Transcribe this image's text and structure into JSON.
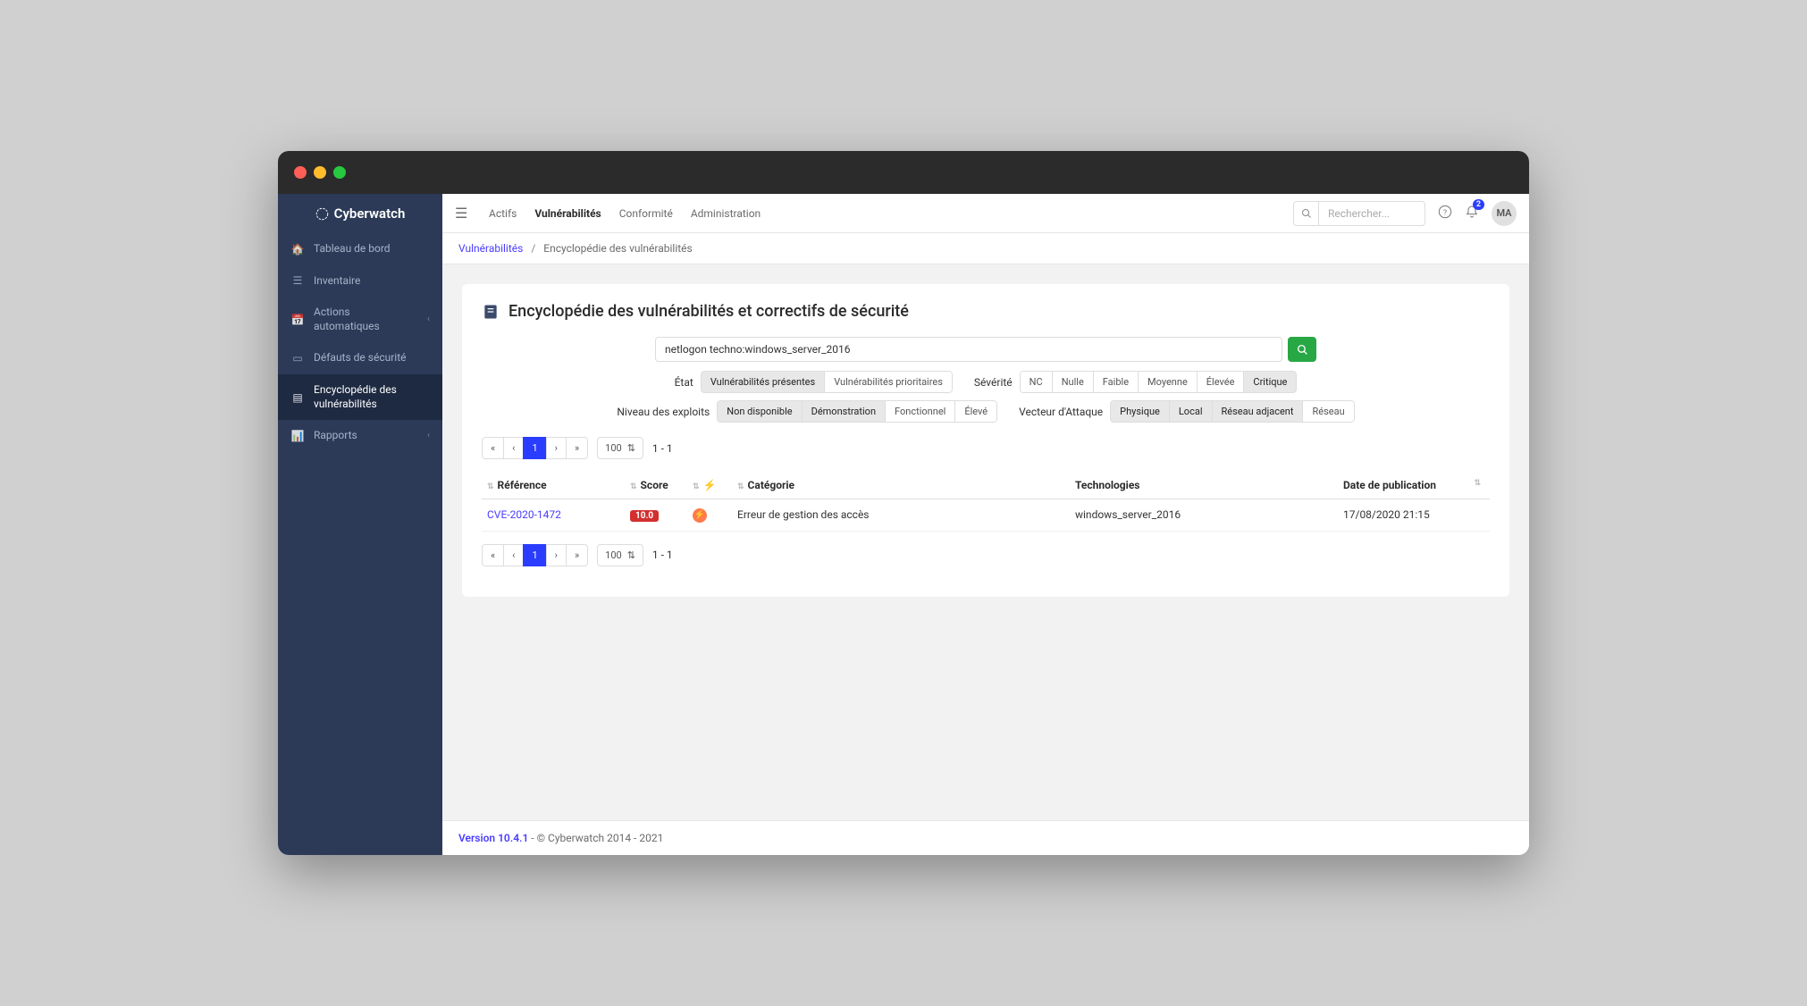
{
  "brand": "Cyberwatch",
  "sidebar": {
    "items": [
      {
        "label": "Tableau de bord"
      },
      {
        "label": "Inventaire"
      },
      {
        "label": "Actions automatiques"
      },
      {
        "label": "Défauts de sécurité"
      },
      {
        "label": "Encyclopédie des vulnérabilités"
      },
      {
        "label": "Rapports"
      }
    ]
  },
  "topnav": {
    "items": [
      {
        "label": "Actifs"
      },
      {
        "label": "Vulnérabilités"
      },
      {
        "label": "Conformité"
      },
      {
        "label": "Administration"
      }
    ],
    "search_placeholder": "Rechercher...",
    "notif_count": "2",
    "avatar": "MA"
  },
  "breadcrumb": {
    "root": "Vulnérabilités",
    "current": "Encyclopédie des vulnérabilités"
  },
  "card": {
    "title": "Encyclopédie des vulnérabilités et correctifs de sécurité",
    "search_value": "netlogon techno:windows_server_2016"
  },
  "filters": {
    "etat": {
      "label": "État",
      "options": [
        "Vulnérabilités présentes",
        "Vulnérabilités prioritaires"
      ],
      "active": [
        0
      ]
    },
    "severite": {
      "label": "Sévérité",
      "options": [
        "NC",
        "Nulle",
        "Faible",
        "Moyenne",
        "Élevée",
        "Critique"
      ],
      "active": [
        5
      ]
    },
    "exploits": {
      "label": "Niveau des exploits",
      "options": [
        "Non disponible",
        "Démonstration",
        "Fonctionnel",
        "Élevé"
      ],
      "active": [
        0,
        1
      ]
    },
    "vecteur": {
      "label": "Vecteur d'Attaque",
      "options": [
        "Physique",
        "Local",
        "Réseau adjacent",
        "Réseau"
      ],
      "active": [
        0,
        1,
        2
      ]
    }
  },
  "pagination": {
    "current": "1",
    "page_size": "100",
    "range": "1 - 1"
  },
  "table": {
    "columns": [
      "Référence",
      "Score",
      "",
      "Catégorie",
      "Technologies",
      "Date de publication"
    ],
    "rows": [
      {
        "ref": "CVE-2020-1472",
        "score": "10.0",
        "cat": "Erreur de gestion des accès",
        "tech": "windows_server_2016",
        "date": "17/08/2020 21:15"
      }
    ]
  },
  "footer": {
    "version": "Version 10.4.1",
    "copyright": " - © Cyberwatch 2014 - 2021"
  }
}
